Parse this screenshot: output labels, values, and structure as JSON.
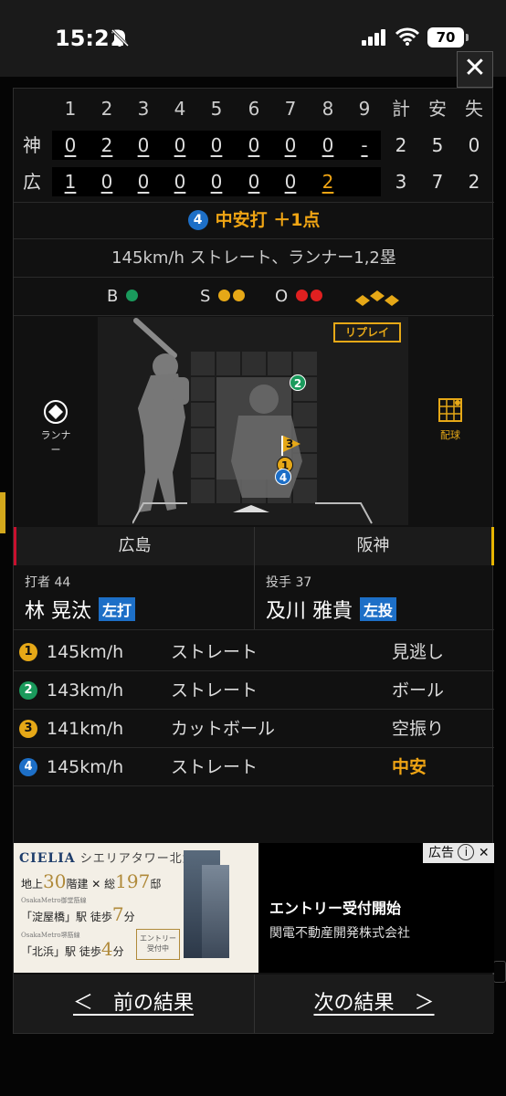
{
  "status": {
    "time": "15:21",
    "battery": "70"
  },
  "close_label": "✕",
  "scoreboard": {
    "innings": [
      "1",
      "2",
      "3",
      "4",
      "5",
      "6",
      "7",
      "8",
      "9"
    ],
    "totals_headers": [
      "計",
      "安",
      "失"
    ],
    "away": {
      "team": "神",
      "scores": [
        "0",
        "2",
        "0",
        "0",
        "0",
        "0",
        "0",
        "0",
        "-"
      ],
      "totals": [
        "2",
        "5",
        "0"
      ]
    },
    "home": {
      "team": "広",
      "scores": [
        "1",
        "0",
        "0",
        "0",
        "0",
        "0",
        "0",
        "2",
        ""
      ],
      "totals": [
        "3",
        "7",
        "2"
      ]
    }
  },
  "result": {
    "number": "4",
    "text": "中安打 ＋1点"
  },
  "pitch_description": "145km/h ストレート、ランナー1,2塁",
  "count": {
    "b": "B",
    "s": "S",
    "o": "O"
  },
  "field": {
    "replay_label": "リプレイ",
    "runner_label": "ランナー",
    "pitch_chart_label": "配球"
  },
  "teams": {
    "away": "広島",
    "home": "阪神"
  },
  "batter": {
    "role": "打者 44",
    "name": "林 晃汰",
    "hand": "左打"
  },
  "pitcher": {
    "role": "投手 37",
    "name": "及川 雅貴",
    "hand": "左投"
  },
  "pitches": [
    {
      "n": "1",
      "speed": "145km/h",
      "type": "ストレート",
      "result": "見逃し",
      "color": "#e6a817"
    },
    {
      "n": "2",
      "speed": "143km/h",
      "type": "ストレート",
      "result": "ボール",
      "color": "#1a9a5c"
    },
    {
      "n": "3",
      "speed": "141km/h",
      "type": "カットボール",
      "result": "空振り",
      "color": "#e6a817"
    },
    {
      "n": "4",
      "speed": "145km/h",
      "type": "ストレート",
      "result": "中安",
      "color": "#1d6fc7"
    }
  ],
  "ad": {
    "label": "広告",
    "logo": "CIELIA",
    "logo_sub": "シエリアタワー北浜",
    "line1_prefix": "地上",
    "line1_floors": "30",
    "line1_mid": "階建 ✕ 総",
    "line1_units": "197",
    "line1_suffix": "邸",
    "line2_small": "OsakaMetro御堂筋線",
    "line2": "「淀屋橋」駅 徒歩",
    "line2_min": "7",
    "line2_suffix": "分",
    "line3_small": "OsakaMetro堺筋線",
    "line3": "「北浜」駅 徒歩",
    "line3_min": "4",
    "line3_suffix": "分",
    "badge": "エントリー受付中",
    "title": "エントリー受付開始",
    "sponsor": "関電不動産開発株式会社"
  },
  "nav": {
    "prev": "＜　前の結果",
    "next": "次の結果　＞"
  }
}
